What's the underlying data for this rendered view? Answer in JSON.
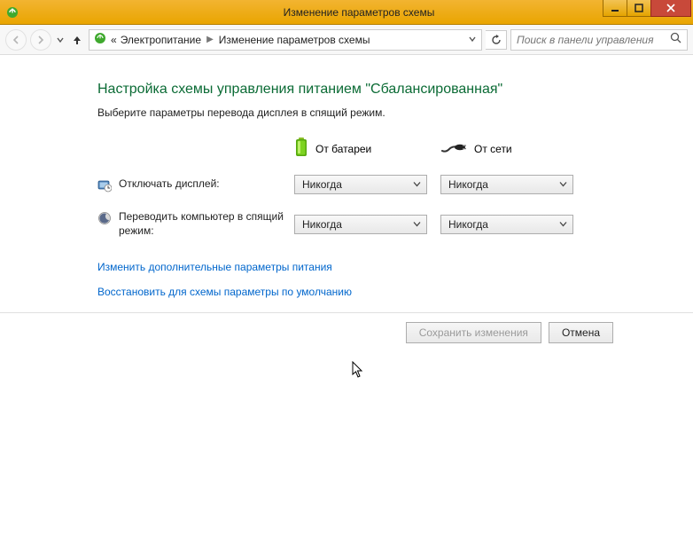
{
  "window": {
    "title": "Изменение параметров схемы"
  },
  "breadcrumb": {
    "left_chevrons": "«",
    "item1": "Электропитание",
    "item2": "Изменение параметров схемы"
  },
  "search": {
    "placeholder": "Поиск в панели управления"
  },
  "page": {
    "heading": "Настройка схемы управления питанием \"Сбалансированная\"",
    "subtitle": "Выберите параметры перевода дисплея в спящий режим."
  },
  "columns": {
    "battery": "От батареи",
    "plugged": "От сети"
  },
  "rows": {
    "display_off": {
      "label": "Отключать дисплей:",
      "battery": "Никогда",
      "plugged": "Никогда"
    },
    "sleep": {
      "label": "Переводить компьютер в спящий режим:",
      "battery": "Никогда",
      "plugged": "Никогда"
    }
  },
  "links": {
    "advanced": "Изменить дополнительные параметры питания",
    "restore": "Восстановить для схемы параметры по умолчанию"
  },
  "buttons": {
    "save": "Сохранить изменения",
    "cancel": "Отмена"
  }
}
